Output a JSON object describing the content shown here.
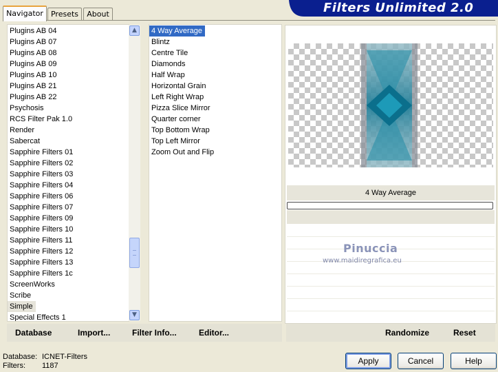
{
  "header": {
    "title": "Filters Unlimited 2.0"
  },
  "tabs": [
    {
      "label": "Navigator",
      "active": true
    },
    {
      "label": "Presets",
      "active": false
    },
    {
      "label": "About",
      "active": false
    }
  ],
  "categories": {
    "items": [
      "Plugins AB 04",
      "Plugins AB 07",
      "Plugins AB 08",
      "Plugins AB 09",
      "Plugins AB 10",
      "Plugins AB 21",
      "Plugins AB 22",
      "Psychosis",
      "RCS Filter Pak 1.0",
      "Render",
      "Sabercat",
      "Sapphire Filters 01",
      "Sapphire Filters 02",
      "Sapphire Filters 03",
      "Sapphire Filters 04",
      "Sapphire Filters 06",
      "Sapphire Filters 07",
      "Sapphire Filters 09",
      "Sapphire Filters 10",
      "Sapphire Filters 11",
      "Sapphire Filters 12",
      "Sapphire Filters 13",
      "Sapphire Filters 1c",
      "ScreenWorks",
      "Scribe",
      "Simple",
      "Special Effects 1"
    ],
    "selected": "Simple"
  },
  "filters": {
    "items": [
      "4 Way Average",
      "Blintz",
      "Centre Tile",
      "Diamonds",
      "Half Wrap",
      "Horizontal Grain",
      "Left Right Wrap",
      "Pizza Slice Mirror",
      "Quarter corner",
      "Top Bottom Wrap",
      "Top Left Mirror",
      "Zoom Out and Flip"
    ],
    "selected": "4 Way Average"
  },
  "preview": {
    "filter_name": "4 Way Average",
    "watermark_name": "Pinuccia",
    "watermark_url": "www.maidiregrafica.eu"
  },
  "toolbar": {
    "database": "Database",
    "import": "Import...",
    "filter_info": "Filter Info...",
    "editor": "Editor...",
    "randomize": "Randomize",
    "reset": "Reset"
  },
  "status": {
    "database_label": "Database:",
    "database_value": "ICNET-Filters",
    "filters_label": "Filters:",
    "filters_value": "1187"
  },
  "buttons": {
    "apply": "Apply",
    "cancel": "Cancel",
    "help": "Help"
  },
  "colors": {
    "banner": "#0a1f8f",
    "selection": "#316ac5",
    "preview_teal": "#1a7f9a"
  }
}
